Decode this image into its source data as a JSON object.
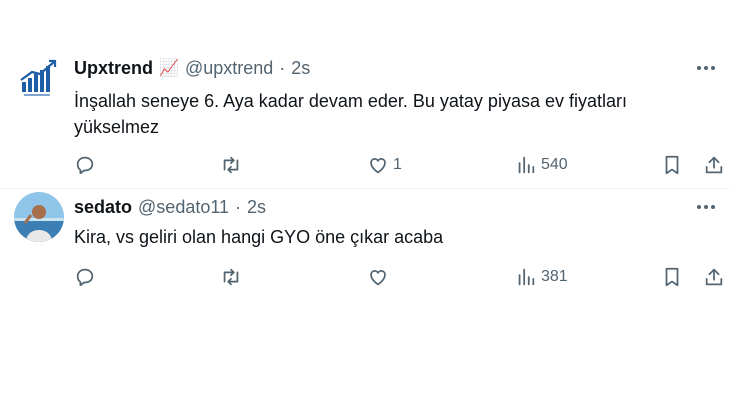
{
  "tweets": [
    {
      "name": "Upxtrend",
      "badge_emoji": "📈",
      "handle": "@upxtrend",
      "separator": "·",
      "time": "2s",
      "text": "İnşallah seneye 6. Aya kadar devam eder. Bu yatay piyasa ev fiyatları yükselmez",
      "likes": "1",
      "views": "540"
    },
    {
      "name": "sedato",
      "handle": "@sedato11",
      "separator": "·",
      "time": "2s",
      "text": "Kira, vs geliri olan hangi GYO öne çıkar acaba",
      "views": "381"
    }
  ],
  "colors": {
    "text_primary": "#0f1419",
    "text_secondary": "#536471",
    "divider": "#eff3f4",
    "upxtrend_logo": "#1f5fa8"
  },
  "icons": [
    "reply-icon",
    "retweet-icon",
    "heart-icon",
    "views-icon",
    "bookmark-icon",
    "share-icon",
    "more-icon"
  ]
}
